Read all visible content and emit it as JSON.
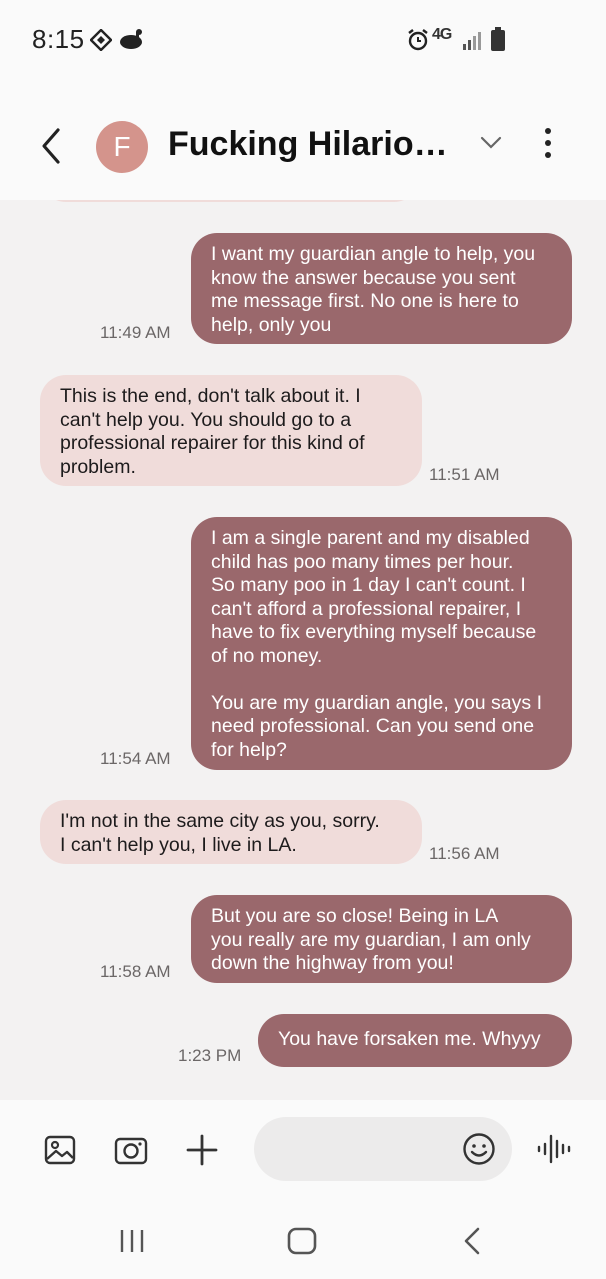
{
  "status_bar": {
    "time": "8:15",
    "network": "4G"
  },
  "header": {
    "avatar_letter": "F",
    "contact_name": "Fucking Hilarious Jokes"
  },
  "messages": [
    {
      "dir": "out",
      "text": "I want my guardian angle to help, you\nknow the answer because you sent\nme message first. No one is here to\nhelp, only you",
      "time": "11:49 AM"
    },
    {
      "dir": "in",
      "text": "This is the end, don't talk about it. I\ncan't help you. You should go to a\nprofessional repairer for this kind of\nproblem.",
      "time": "11:51 AM"
    },
    {
      "dir": "out",
      "text": "I am a single parent and my disabled\nchild has poo many times per hour.\nSo many poo in 1 day I can't count. I\ncan't afford a professional repairer, I\nhave to fix everything myself because\nof no money.\n\nYou are my guardian angle, you says I\nneed professional. Can you send one\nfor help?",
      "time": "11:54 AM"
    },
    {
      "dir": "in",
      "text": "I'm not in the same city as you, sorry.\nI can't help you, I live in LA.",
      "time": "11:56 AM"
    },
    {
      "dir": "out",
      "text": "But you are so close! Being in LA\nyou really are my guardian, I am only\ndown the highway from you!",
      "time": "11:58 AM"
    },
    {
      "dir": "out",
      "text": "You have forsaken me. Whyyy",
      "time": "1:23 PM"
    }
  ],
  "composer": {
    "placeholder": ""
  },
  "colors": {
    "outgoing_bubble": "#9a686c",
    "incoming_bubble": "#f0dcda",
    "avatar": "#d4948c"
  },
  "icons": [
    "back-arrow-icon",
    "chevron-down-icon",
    "more-options-icon",
    "gallery-icon",
    "camera-icon",
    "plus-icon",
    "emoji-icon",
    "voice-wave-icon",
    "recent-apps-icon",
    "home-icon",
    "nav-back-icon"
  ]
}
